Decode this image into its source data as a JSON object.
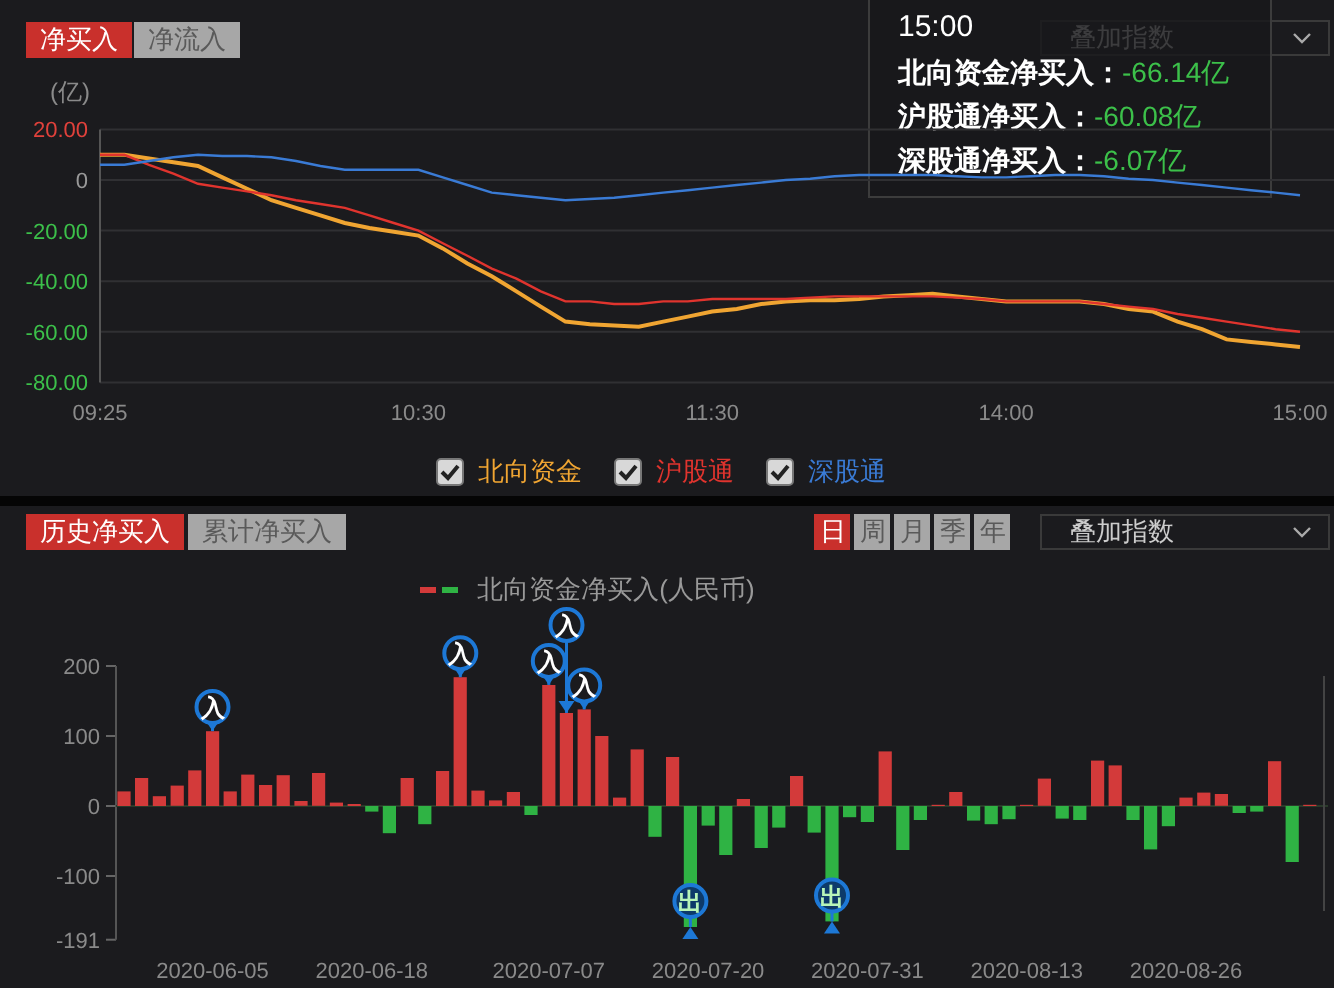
{
  "top": {
    "tabs": [
      {
        "label": "净买入",
        "selected": true
      },
      {
        "label": "净流入",
        "selected": false
      }
    ],
    "index_overlay_dropdown": {
      "label": "叠加指数"
    },
    "unit": "(亿)",
    "chart_data": {
      "type": "line",
      "categories": [
        "09:25",
        null,
        null,
        null,
        null,
        null,
        null,
        null,
        null,
        null,
        null,
        null,
        null,
        "10:30",
        null,
        null,
        null,
        null,
        null,
        null,
        null,
        null,
        null,
        null,
        null,
        "11:30",
        null,
        null,
        null,
        null,
        null,
        null,
        null,
        null,
        null,
        null,
        null,
        "14:00",
        null,
        null,
        null,
        null,
        null,
        null,
        null,
        null,
        null,
        null,
        null,
        "15:00"
      ],
      "series": [
        {
          "name": "北向资金",
          "color": "#f0a532",
          "values": [
            10,
            10,
            8.5,
            7,
            5.5,
            1,
            -3.5,
            -8,
            -11,
            -14,
            -17,
            -19,
            -20.5,
            -22,
            -27,
            -33,
            -38,
            -44,
            -50,
            -56,
            -57,
            -57.5,
            -58,
            -56,
            -54,
            -52,
            -51,
            -49,
            -48,
            -47.5,
            -47.5,
            -47,
            -46,
            -45.5,
            -45,
            -46,
            -47,
            -48,
            -48,
            -48,
            -48,
            -49,
            -51,
            -52,
            -56,
            -59,
            -63,
            -64,
            -65,
            -66
          ]
        },
        {
          "name": "沪股通",
          "color": "#e0342e",
          "values": [
            10,
            10,
            6,
            2.5,
            -1.5,
            -3,
            -4.5,
            -6,
            -8,
            -9.5,
            -11,
            -14,
            -17,
            -20,
            -25,
            -30,
            -35,
            -39,
            -44,
            -48,
            -48,
            -49,
            -49,
            -48,
            -48,
            -47,
            -47,
            -47,
            -47,
            -46.5,
            -46,
            -46,
            -46,
            -46,
            -46,
            -46.5,
            -47,
            -48,
            -48,
            -48,
            -48,
            -49,
            -50,
            -51,
            -53,
            -54.5,
            -56,
            -57.5,
            -59,
            -60
          ]
        },
        {
          "name": "深股通",
          "color": "#3a7bd5",
          "values": [
            6,
            6,
            7.5,
            9,
            10,
            9.5,
            9.5,
            9,
            7.5,
            5.5,
            4,
            4,
            4,
            4,
            1,
            -2,
            -5,
            -6,
            -7,
            -8,
            -7.5,
            -7,
            -6,
            -5,
            -4,
            -3,
            -2,
            -1,
            0,
            0.5,
            1.5,
            2,
            2,
            2,
            2,
            1.5,
            1,
            1,
            1.5,
            2,
            2,
            1.5,
            0.5,
            0,
            -1,
            -2,
            -3,
            -4,
            -5,
            -6
          ]
        }
      ],
      "ylim": [
        -80,
        20
      ],
      "grid": true,
      "yticks": [
        {
          "value": 20,
          "label": "20.00"
        },
        {
          "value": 0,
          "label": "0"
        },
        {
          "value": -20,
          "label": "-20.00"
        },
        {
          "value": -40,
          "label": "-40.00"
        },
        {
          "value": -60,
          "label": "-60.00"
        },
        {
          "value": -80,
          "label": "-80.00"
        }
      ]
    },
    "legend": [
      {
        "checked": true
      },
      {
        "checked": true
      },
      {
        "checked": true
      }
    ],
    "tooltip": {
      "time": "15:00",
      "rows": [
        {
          "label": "北向资金净买入：",
          "value": "-66.14亿"
        },
        {
          "label": "沪股通净买入：",
          "value": "-60.08亿"
        },
        {
          "label": "深股通净买入：",
          "value": "-6.07亿"
        }
      ]
    }
  },
  "bottom": {
    "tabs": [
      {
        "label": "历史净买入",
        "selected": true
      },
      {
        "label": "累计净买入",
        "selected": false
      }
    ],
    "periods": [
      {
        "label": "日",
        "selected": true
      },
      {
        "label": "周",
        "selected": false
      },
      {
        "label": "月",
        "selected": false
      },
      {
        "label": "季",
        "selected": false
      },
      {
        "label": "年",
        "selected": false
      }
    ],
    "index_overlay_dropdown": {
      "label": "叠加指数"
    },
    "chart_data": {
      "type": "bar",
      "categories": [
        null,
        null,
        null,
        null,
        null,
        "2020-06-05",
        null,
        null,
        null,
        null,
        null,
        null,
        null,
        null,
        "2020-06-18",
        null,
        null,
        null,
        null,
        null,
        null,
        null,
        null,
        null,
        "2020-07-07",
        null,
        null,
        null,
        null,
        null,
        null,
        null,
        null,
        "2020-07-20",
        null,
        null,
        null,
        null,
        null,
        null,
        null,
        null,
        "2020-07-31",
        null,
        null,
        null,
        null,
        null,
        null,
        null,
        null,
        "2020-08-13",
        null,
        null,
        null,
        null,
        null,
        null,
        null,
        null,
        "2020-08-26",
        null,
        null,
        null,
        null,
        null,
        null,
        null
      ],
      "series": [
        {
          "name": "北向资金净买入(人民币)",
          "values": [
            21,
            40,
            14,
            29,
            51,
            107,
            21,
            45,
            30,
            44,
            7,
            47,
            5,
            3,
            -8,
            -39,
            40,
            -26,
            50,
            184,
            22,
            8,
            20,
            -13,
            173,
            133,
            138,
            100,
            12,
            81,
            -44,
            70,
            -173,
            -28,
            -70,
            10,
            -60,
            -31,
            43,
            -38,
            -165,
            -16,
            -23,
            78,
            -63,
            -20,
            1,
            20,
            -21,
            -26,
            -19,
            0,
            39,
            -18,
            -20,
            65,
            58,
            -20,
            -62,
            -29,
            12,
            19,
            17,
            -10,
            -8,
            64,
            -80,
            0
          ]
        }
      ],
      "ylim": [
        -191,
        200
      ],
      "yticks": [
        200,
        100,
        0,
        -100,
        -191
      ],
      "annotations": [
        {
          "y": 107,
          "text": "入"
        },
        {
          "y": 184,
          "text": "入"
        },
        {
          "y": 173,
          "text": "入"
        },
        {
          "y": 133,
          "text": "入"
        },
        {
          "y": 138,
          "text": "入"
        },
        {
          "y": -173,
          "text": "出"
        },
        {
          "y": -165,
          "text": "出"
        }
      ]
    }
  }
}
